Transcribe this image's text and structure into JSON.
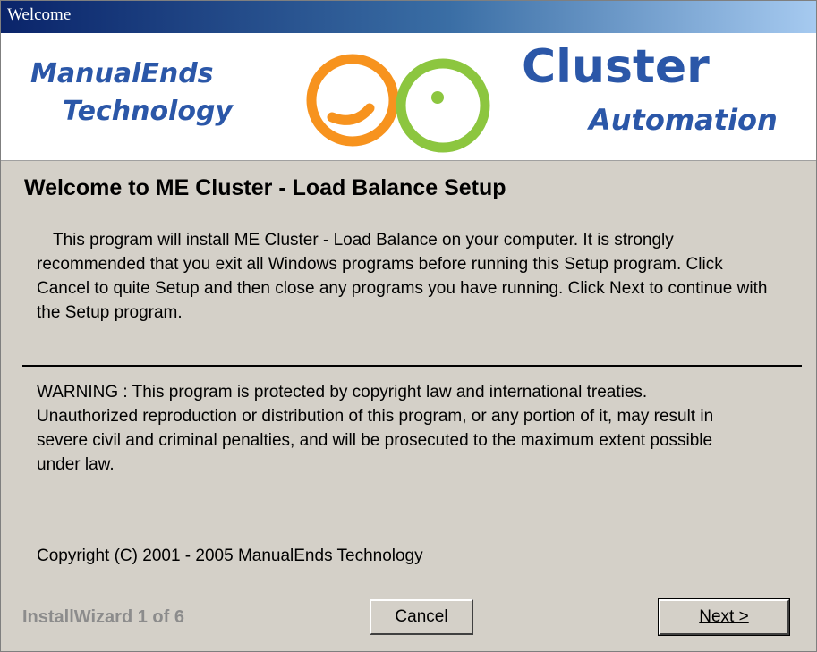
{
  "window": {
    "title": "Welcome"
  },
  "banner": {
    "company_line1": "ManualEnds",
    "company_line2": "Technology",
    "product_name": "Cluster",
    "product_sub": "Automation",
    "logo_colors": {
      "orange": "#f7931e",
      "green": "#8cc63f"
    }
  },
  "content": {
    "heading": "Welcome to ME Cluster - Load Balance Setup",
    "intro": "This program will install ME Cluster - Load Balance on your computer.  It is strongly recommended that you exit all Windows programs before running this Setup program.  Click Cancel to quite Setup and then close any programs you have running.  Click Next to continue with the Setup program.",
    "warning": "WARNING : This program is protected by copyright law and international treaties.  Unauthorized reproduction or distribution of this program, or any portion of it, may result in severe civil and criminal penalties, and will be prosecuted to the maximum extent possible under law.",
    "copyright": "Copyright (C) 2001 - 2005 ManualEnds Technology"
  },
  "footer": {
    "step_label": "InstallWizard 1 of 6",
    "cancel_label": "Cancel",
    "next_label": "Next >"
  },
  "colors": {
    "brand_blue": "#2b57a8",
    "dialog_gray": "#d4d0c8",
    "titlebar_start": "#0a246a"
  }
}
